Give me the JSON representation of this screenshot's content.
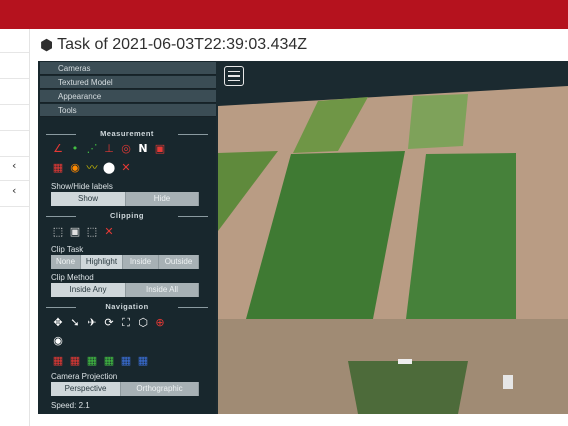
{
  "header": {
    "title": "Task of 2021-06-03T22:39:03.434Z"
  },
  "left_nav": {
    "chevrons": [
      "‹",
      "‹"
    ]
  },
  "sidebar": {
    "accordion": [
      "Cameras",
      "Textured Model",
      "Appearance",
      "Tools"
    ],
    "measurement": {
      "title": "Measurement",
      "tools": [
        "angle-icon",
        "point-icon",
        "distance-icon",
        "height-icon",
        "circle-icon",
        "north-arrow-icon",
        "area-icon",
        "volume-icon",
        "profile-icon",
        "annotation-icon",
        "remove-all-icon"
      ],
      "show_hide_label": "Show/Hide labels",
      "show_label": "Show",
      "hide_label": "Hide"
    },
    "clipping": {
      "title": "Clipping",
      "clip_task_label": "Clip Task",
      "clip_task_options": [
        "None",
        "Highlight",
        "Inside",
        "Outside"
      ],
      "clip_task_selected": "Highlight",
      "clip_method_label": "Clip Method",
      "clip_method_options": [
        "Inside Any",
        "Inside All"
      ],
      "clip_method_selected": "Inside Any"
    },
    "navigation": {
      "title": "Navigation",
      "camera_projection_label": "Camera Projection",
      "projection_options": [
        "Perspective",
        "Orthographic"
      ],
      "projection_selected": "Perspective",
      "speed_label": "Speed: 2.1"
    }
  },
  "colors": {
    "brand_bar": "#b5121e",
    "panel_bg": "#18272d",
    "accordion_bg": "#3b4d55",
    "tool_red": "#e53935",
    "tool_green": "#43c043"
  }
}
